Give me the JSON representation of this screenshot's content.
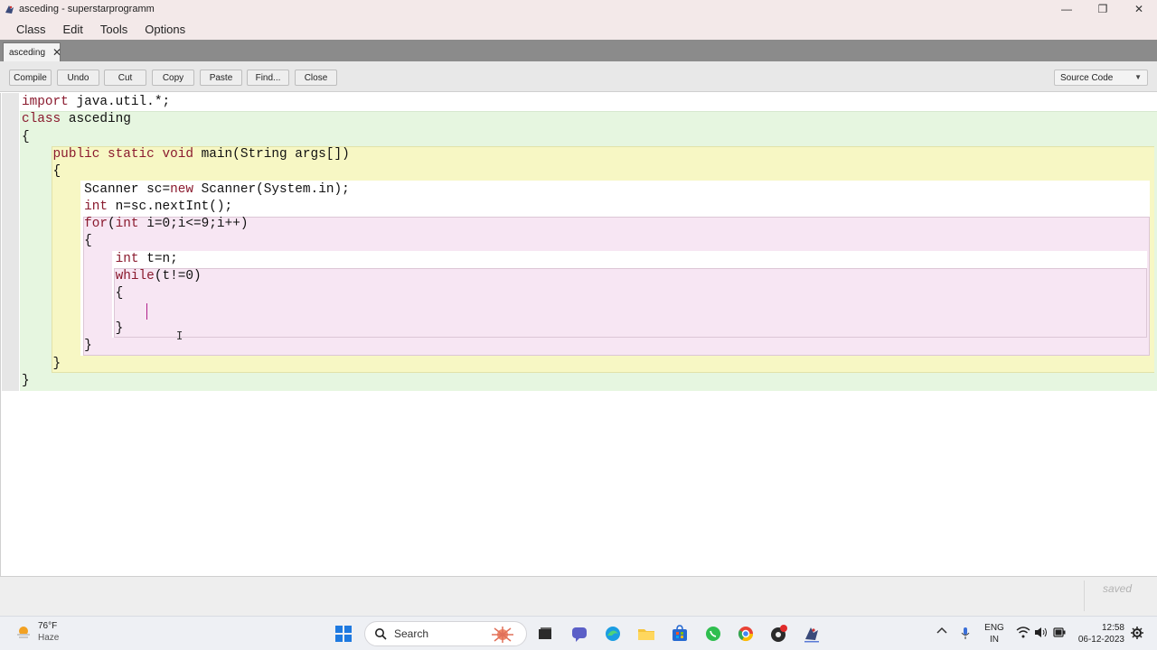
{
  "window": {
    "title": "asceding - superstarprogramm",
    "minimize_glyph": "—",
    "restore_glyph": "❐",
    "close_glyph": "✕"
  },
  "menu": [
    "Class",
    "Edit",
    "Tools",
    "Options"
  ],
  "tab": {
    "label": "asceding",
    "close_glyph": "✕"
  },
  "toolbar": {
    "buttons": [
      "Compile",
      "Undo",
      "Cut",
      "Copy",
      "Paste",
      "Find...",
      "Close"
    ],
    "view_select": "Source Code"
  },
  "editor": {
    "lines": [
      [
        {
          "t": "import",
          "k": true
        },
        {
          "t": " java.util.*;"
        }
      ],
      [
        {
          "t": "class",
          "k": true
        },
        {
          "t": " asceding"
        }
      ],
      [
        {
          "t": "{"
        }
      ],
      [
        {
          "t": "    "
        },
        {
          "t": "public static void",
          "k": true
        },
        {
          "t": " main(String args[])"
        }
      ],
      [
        {
          "t": "    {"
        }
      ],
      [
        {
          "t": "        Scanner sc="
        },
        {
          "t": "new",
          "k": true
        },
        {
          "t": " Scanner(System.in);"
        }
      ],
      [
        {
          "t": "        "
        },
        {
          "t": "int",
          "k": true
        },
        {
          "t": " n=sc.nextInt();"
        }
      ],
      [
        {
          "t": "        "
        },
        {
          "t": "for",
          "k": true
        },
        {
          "t": "("
        },
        {
          "t": "int",
          "k": true
        },
        {
          "t": " i=0;i<=9;i++)"
        }
      ],
      [
        {
          "t": "        {"
        }
      ],
      [
        {
          "t": "            "
        },
        {
          "t": "int",
          "k": true
        },
        {
          "t": " t=n;"
        }
      ],
      [
        {
          "t": "            "
        },
        {
          "t": "while",
          "k": true
        },
        {
          "t": "(t!=0)"
        }
      ],
      [
        {
          "t": "            {"
        }
      ],
      [
        {
          "t": ""
        }
      ],
      [
        {
          "t": "            }"
        }
      ],
      [
        {
          "t": "        }"
        }
      ],
      [
        {
          "t": "    }"
        }
      ],
      [
        {
          "t": "}"
        }
      ]
    ],
    "ibeam_glyph": "I"
  },
  "status": {
    "text": "saved"
  },
  "taskbar": {
    "weather_temp": "76°F",
    "weather_desc": "Haze",
    "search_label": "Search",
    "lang_top": "ENG",
    "lang_bottom": "IN",
    "time": "12:58",
    "date": "06-12-2023"
  }
}
